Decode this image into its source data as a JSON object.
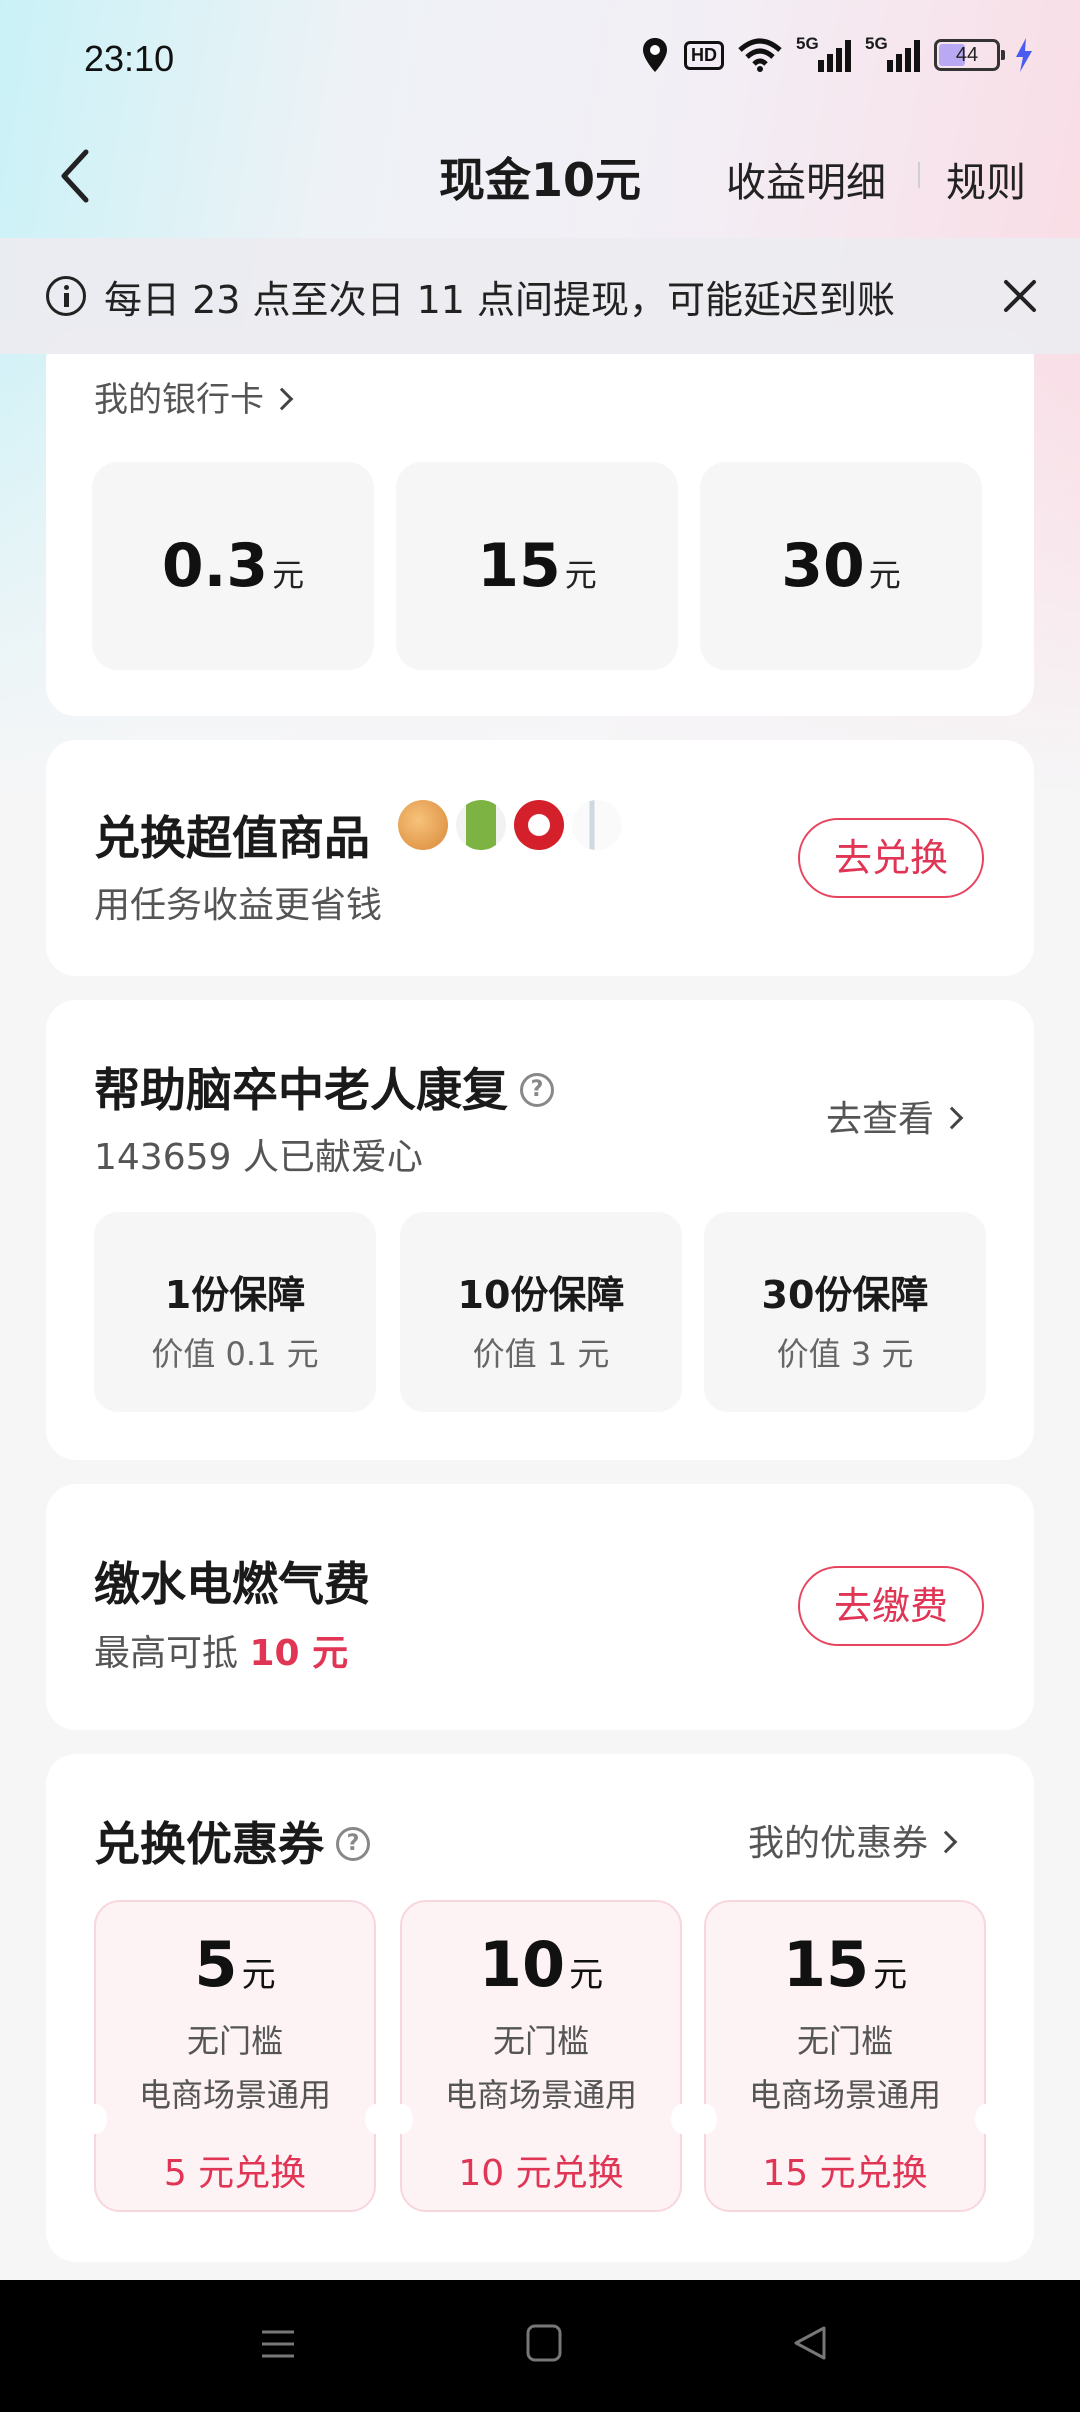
{
  "status_bar": {
    "time": "23:10",
    "hd": "HD",
    "net1": "5G",
    "net2": "5G",
    "battery": "44"
  },
  "header": {
    "title": "现金10元",
    "link_details": "收益明细",
    "link_rules": "规则"
  },
  "notice": {
    "text": "每日 23 点至次日 11 点间提现，可能延迟到账"
  },
  "withdraw": {
    "bank_card_label": "我的银行卡",
    "amounts": [
      {
        "value": "0.3",
        "unit": "元"
      },
      {
        "value": "15",
        "unit": "元"
      },
      {
        "value": "30",
        "unit": "元"
      }
    ]
  },
  "exchange_goods": {
    "title": "兑换超值商品",
    "subtitle": "用任务收益更省钱",
    "button": "去兑换"
  },
  "charity": {
    "title": "帮助脑卒中老人康复",
    "count": "143659 人已献爱心",
    "link": "去查看",
    "options": [
      {
        "title": "1份保障",
        "value": "价值 0.1 元"
      },
      {
        "title": "10份保障",
        "value": "价值 1 元"
      },
      {
        "title": "30份保障",
        "value": "价值 3 元"
      }
    ]
  },
  "utilities": {
    "title": "缴水电燃气费",
    "subtitle_prefix": "最高可抵",
    "subtitle_amount": "10 元",
    "button": "去缴费"
  },
  "coupons": {
    "title": "兑换优惠券",
    "link": "我的优惠券",
    "items": [
      {
        "value": "5",
        "unit": "元",
        "line1": "无门槛",
        "line2": "电商场景通用",
        "button": "5 元兑换"
      },
      {
        "value": "10",
        "unit": "元",
        "line1": "无门槛",
        "line2": "电商场景通用",
        "button": "10 元兑换"
      },
      {
        "value": "15",
        "unit": "元",
        "line1": "无门槛",
        "line2": "电商场景通用",
        "button": "15 元兑换"
      }
    ]
  },
  "colors": {
    "accent": "#e03555",
    "card_bg": "#ffffff",
    "tile_bg": "#f6f6f6",
    "coupon_bg": "#fdf2f4"
  }
}
